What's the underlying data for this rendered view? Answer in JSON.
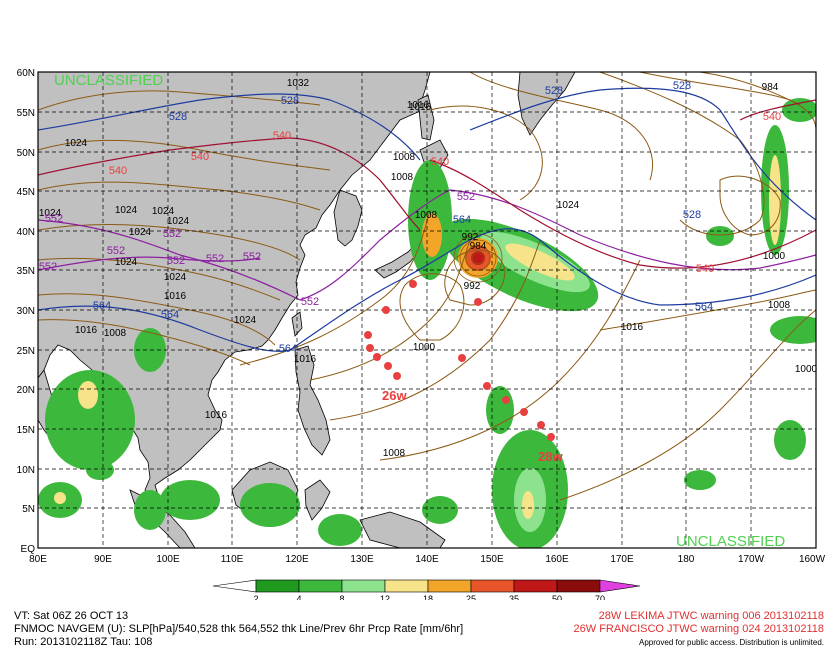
{
  "map": {
    "classification_top": "UNCLASSIFIED",
    "classification_bottom": "UNCLASSIFIED",
    "lat_labels": [
      "60N",
      "55N",
      "50N",
      "45N",
      "40N",
      "35N",
      "30N",
      "25N",
      "20N",
      "15N",
      "10N",
      "5N",
      "EQ"
    ],
    "lon_labels": [
      "80E",
      "90E",
      "100E",
      "110E",
      "120E",
      "130E",
      "140E",
      "150E",
      "160E",
      "170E",
      "180",
      "170W",
      "160W"
    ],
    "pressure_labels": [
      "1032",
      "1024",
      "1024",
      "1024",
      "1024",
      "1024",
      "1024",
      "1024",
      "1024",
      "1024",
      "1016",
      "1008",
      "1008",
      "1016",
      "1016",
      "1016",
      "1008",
      "1000",
      "992",
      "992",
      "984",
      "984",
      "1024",
      "1008",
      "1008",
      "1016",
      "1000",
      "1016",
      "1016",
      "1008",
      "1000"
    ],
    "thickness_labels_540": [
      "540",
      "540",
      "540",
      "540",
      "540",
      "540"
    ],
    "thickness_labels_552": [
      "552",
      "552",
      "552",
      "552",
      "552",
      "552",
      "552",
      "552",
      "552"
    ],
    "thickness_labels_528": [
      "528",
      "528",
      "528",
      "528",
      "528"
    ],
    "thickness_labels_564": [
      "564",
      "564",
      "564",
      "564",
      "564"
    ],
    "storm_labels": [
      "26w",
      "28w"
    ],
    "colors": {
      "land": "#c0c0c0",
      "sea": "#ffffff",
      "pressure": "#8b5a14",
      "thickness_low": "#1e3ca0",
      "thickness_mid": "#8c1fa0",
      "thickness_540": "#a01030",
      "storm_track": "#e84040",
      "classification": "#50d050"
    }
  },
  "colorbar": {
    "ticks": [
      "2",
      "4",
      "8",
      "12",
      "18",
      "25",
      "35",
      "50",
      "70"
    ],
    "colors": [
      "#1f9a1f",
      "#3cb83c",
      "#8de38d",
      "#f7e38a",
      "#f3a52a",
      "#e8552a",
      "#c01818",
      "#8a0c0c",
      "#e040e0"
    ]
  },
  "footer": {
    "line1": "VT: Sat 06Z 26 OCT 13",
    "line2": "FNMOC NAVGEM (U): SLP[hPa]/540,528 thk 564,552 thk Line/Prev 6hr Prcp Rate [mm/6hr]",
    "line3": "Run: 2013102118Z Tau: 108",
    "warning1": "28W LEKIMA JTWC warning 006 2013102118",
    "warning2": "26W FRANCISCO JTWC warning 024 2013102118",
    "approved": "Approved for public access. Distribution is unlimited."
  }
}
